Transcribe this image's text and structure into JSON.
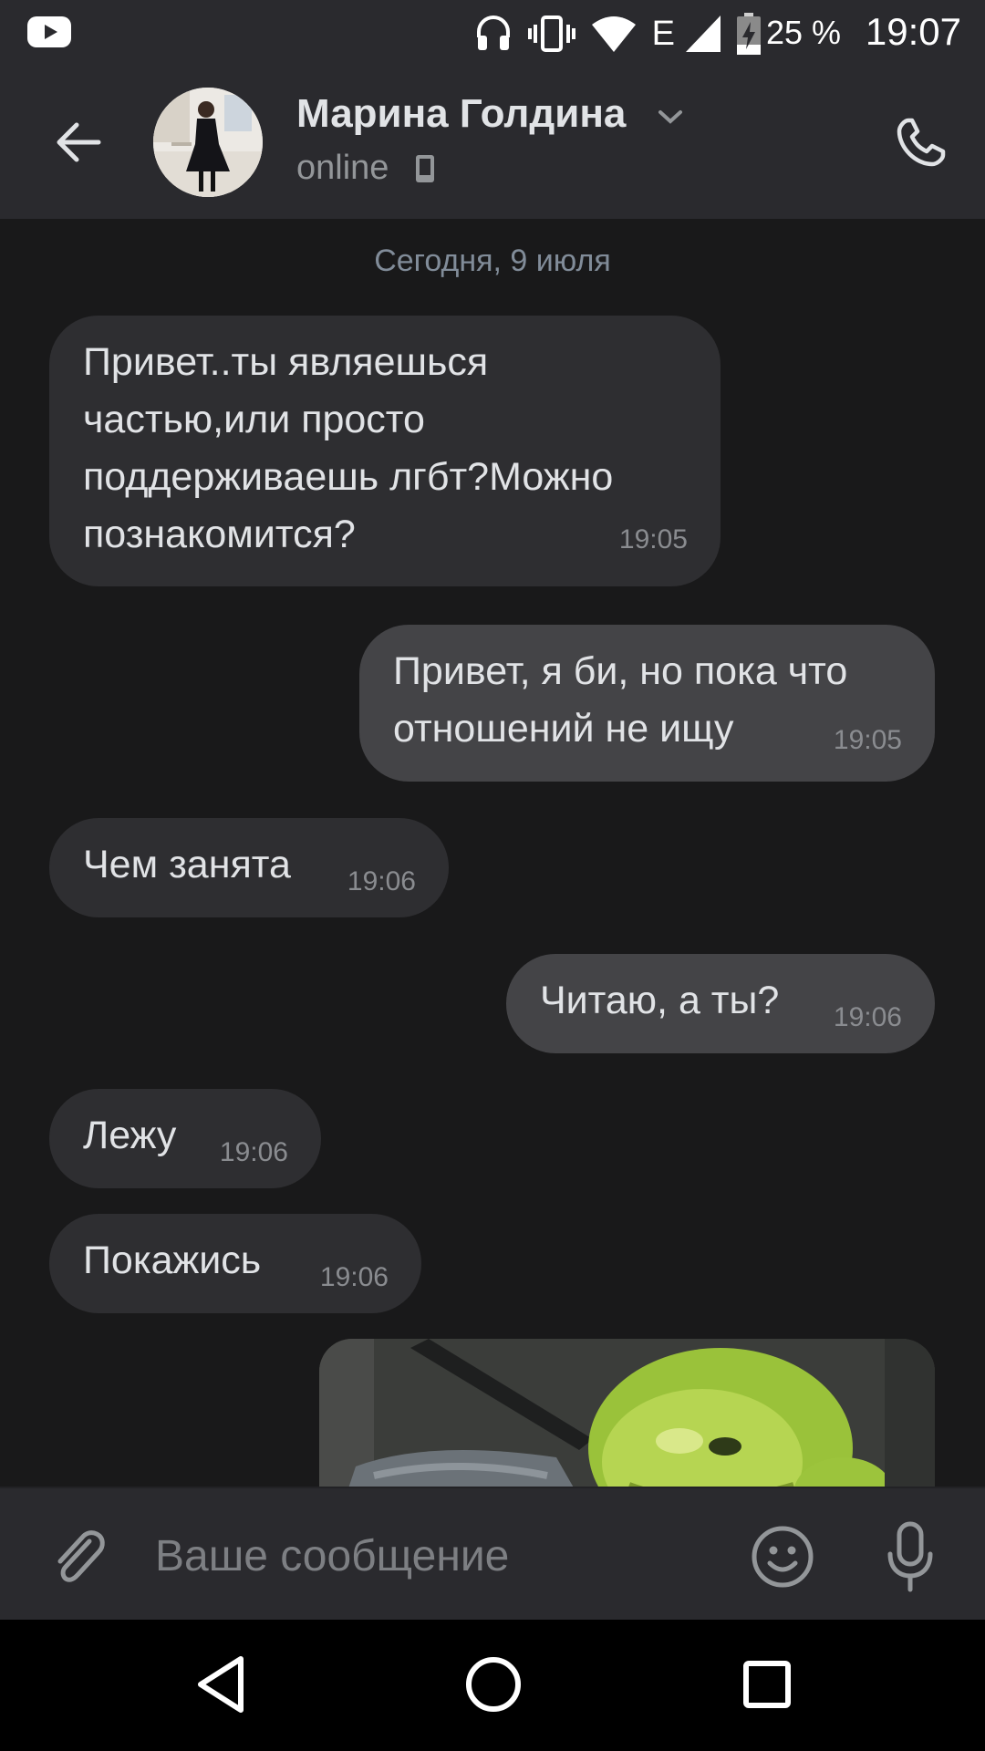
{
  "status_bar": {
    "battery_percent": "25 %",
    "time": "19:07",
    "network_type": "E",
    "battery_level": 0.25
  },
  "header": {
    "contact_name": "Марина Голдина",
    "presence": "online",
    "icons": [
      "back-arrow-icon",
      "chevron-down-icon",
      "mobile-device-icon",
      "phone-icon"
    ]
  },
  "chat": {
    "date_separator": "Сегодня, 9 июля",
    "messages": [
      {
        "direction": "in",
        "text": "Привет..ты являешься\nчастью,или просто\nподдерживаешь лгбт?Можно\nпознакомится?",
        "time": "19:05"
      },
      {
        "direction": "out",
        "text": "Привет, я би, но пока что\nотношений не ищу",
        "time": "19:05"
      },
      {
        "direction": "in",
        "text": "Чем занята",
        "time": "19:06"
      },
      {
        "direction": "out",
        "text": "Читаю, а ты?",
        "time": "19:06"
      },
      {
        "direction": "in",
        "text": "Лежу",
        "time": "19:06"
      },
      {
        "direction": "in",
        "text": "Покажись",
        "time": "19:06"
      }
    ],
    "last_attachment": "photo"
  },
  "composer": {
    "placeholder": "Ваше сообщение",
    "value": "",
    "icons": [
      "paperclip-icon",
      "emoji-icon",
      "microphone-icon"
    ]
  },
  "navigation_bar": {
    "icons": [
      "nav-back-icon",
      "nav-home-icon",
      "nav-recents-icon"
    ]
  },
  "colors": {
    "background": "#19191a",
    "header": "#2a2a2e",
    "incoming_bubble": "#2e2e31",
    "outgoing_bubble": "#444447",
    "text": "#e1e3e6",
    "secondary_text": "#939699"
  }
}
